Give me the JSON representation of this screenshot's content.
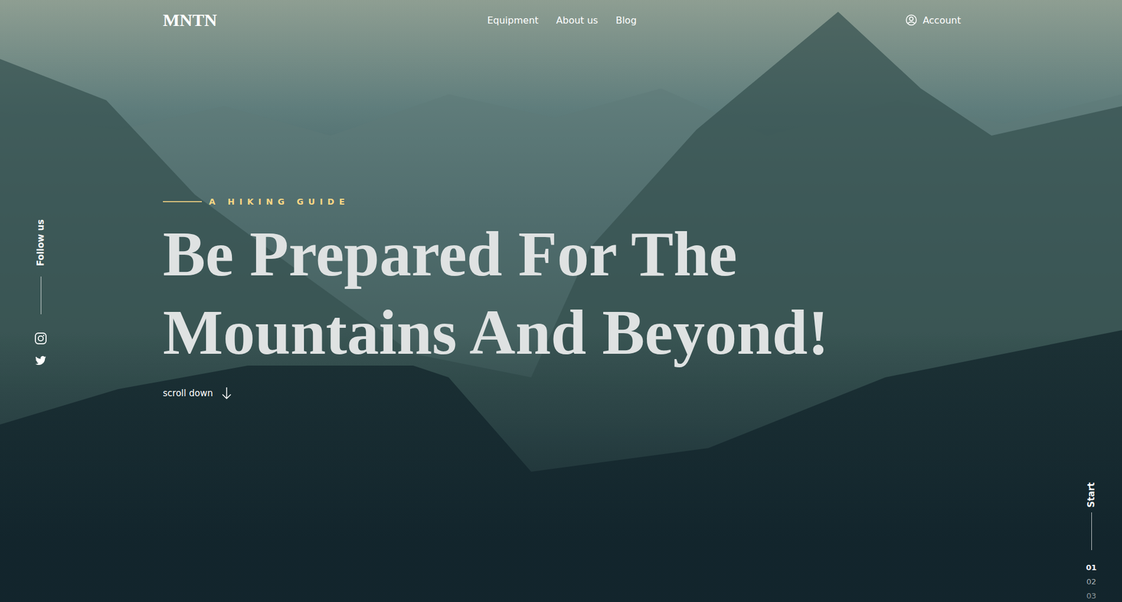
{
  "logo": "MNTN",
  "nav": [
    {
      "label": "Equipment"
    },
    {
      "label": "About us"
    },
    {
      "label": "Blog"
    }
  ],
  "account": {
    "label": "Account"
  },
  "hero": {
    "eyebrow": "A HIKING GUIDE",
    "title_lines": [
      "Be Prepared For The",
      "Mountains And Beyond!"
    ],
    "scroll": "scroll down"
  },
  "social": {
    "label": "Follow us"
  },
  "pager": {
    "label": "Start",
    "pages": [
      {
        "label": "01",
        "selected": true
      },
      {
        "label": "02",
        "selected": false
      },
      {
        "label": "03",
        "selected": false
      }
    ]
  }
}
